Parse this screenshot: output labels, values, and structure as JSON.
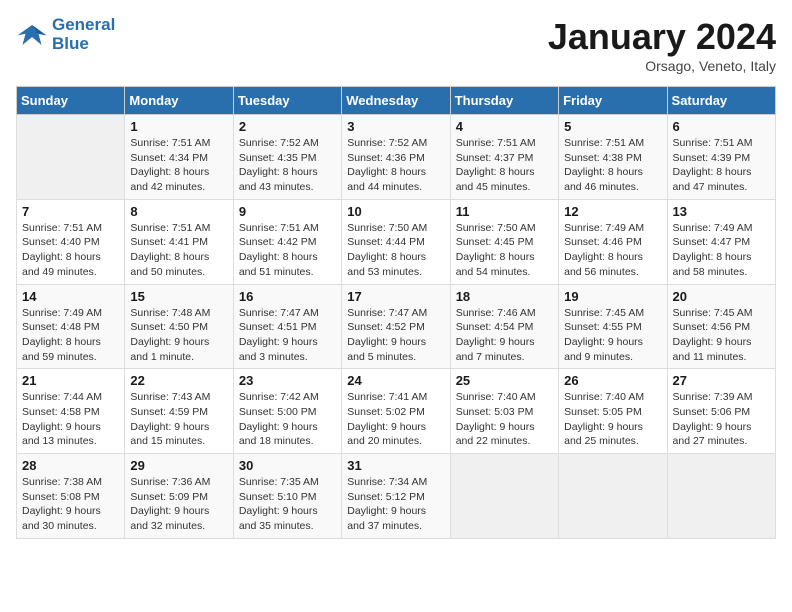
{
  "header": {
    "logo_line1": "General",
    "logo_line2": "Blue",
    "month_title": "January 2024",
    "location": "Orsago, Veneto, Italy"
  },
  "days_of_week": [
    "Sunday",
    "Monday",
    "Tuesday",
    "Wednesday",
    "Thursday",
    "Friday",
    "Saturday"
  ],
  "weeks": [
    [
      {
        "day": "",
        "info": ""
      },
      {
        "day": "1",
        "info": "Sunrise: 7:51 AM\nSunset: 4:34 PM\nDaylight: 8 hours\nand 42 minutes."
      },
      {
        "day": "2",
        "info": "Sunrise: 7:52 AM\nSunset: 4:35 PM\nDaylight: 8 hours\nand 43 minutes."
      },
      {
        "day": "3",
        "info": "Sunrise: 7:52 AM\nSunset: 4:36 PM\nDaylight: 8 hours\nand 44 minutes."
      },
      {
        "day": "4",
        "info": "Sunrise: 7:51 AM\nSunset: 4:37 PM\nDaylight: 8 hours\nand 45 minutes."
      },
      {
        "day": "5",
        "info": "Sunrise: 7:51 AM\nSunset: 4:38 PM\nDaylight: 8 hours\nand 46 minutes."
      },
      {
        "day": "6",
        "info": "Sunrise: 7:51 AM\nSunset: 4:39 PM\nDaylight: 8 hours\nand 47 minutes."
      }
    ],
    [
      {
        "day": "7",
        "info": "Sunrise: 7:51 AM\nSunset: 4:40 PM\nDaylight: 8 hours\nand 49 minutes."
      },
      {
        "day": "8",
        "info": "Sunrise: 7:51 AM\nSunset: 4:41 PM\nDaylight: 8 hours\nand 50 minutes."
      },
      {
        "day": "9",
        "info": "Sunrise: 7:51 AM\nSunset: 4:42 PM\nDaylight: 8 hours\nand 51 minutes."
      },
      {
        "day": "10",
        "info": "Sunrise: 7:50 AM\nSunset: 4:44 PM\nDaylight: 8 hours\nand 53 minutes."
      },
      {
        "day": "11",
        "info": "Sunrise: 7:50 AM\nSunset: 4:45 PM\nDaylight: 8 hours\nand 54 minutes."
      },
      {
        "day": "12",
        "info": "Sunrise: 7:49 AM\nSunset: 4:46 PM\nDaylight: 8 hours\nand 56 minutes."
      },
      {
        "day": "13",
        "info": "Sunrise: 7:49 AM\nSunset: 4:47 PM\nDaylight: 8 hours\nand 58 minutes."
      }
    ],
    [
      {
        "day": "14",
        "info": "Sunrise: 7:49 AM\nSunset: 4:48 PM\nDaylight: 8 hours\nand 59 minutes."
      },
      {
        "day": "15",
        "info": "Sunrise: 7:48 AM\nSunset: 4:50 PM\nDaylight: 9 hours\nand 1 minute."
      },
      {
        "day": "16",
        "info": "Sunrise: 7:47 AM\nSunset: 4:51 PM\nDaylight: 9 hours\nand 3 minutes."
      },
      {
        "day": "17",
        "info": "Sunrise: 7:47 AM\nSunset: 4:52 PM\nDaylight: 9 hours\nand 5 minutes."
      },
      {
        "day": "18",
        "info": "Sunrise: 7:46 AM\nSunset: 4:54 PM\nDaylight: 9 hours\nand 7 minutes."
      },
      {
        "day": "19",
        "info": "Sunrise: 7:45 AM\nSunset: 4:55 PM\nDaylight: 9 hours\nand 9 minutes."
      },
      {
        "day": "20",
        "info": "Sunrise: 7:45 AM\nSunset: 4:56 PM\nDaylight: 9 hours\nand 11 minutes."
      }
    ],
    [
      {
        "day": "21",
        "info": "Sunrise: 7:44 AM\nSunset: 4:58 PM\nDaylight: 9 hours\nand 13 minutes."
      },
      {
        "day": "22",
        "info": "Sunrise: 7:43 AM\nSunset: 4:59 PM\nDaylight: 9 hours\nand 15 minutes."
      },
      {
        "day": "23",
        "info": "Sunrise: 7:42 AM\nSunset: 5:00 PM\nDaylight: 9 hours\nand 18 minutes."
      },
      {
        "day": "24",
        "info": "Sunrise: 7:41 AM\nSunset: 5:02 PM\nDaylight: 9 hours\nand 20 minutes."
      },
      {
        "day": "25",
        "info": "Sunrise: 7:40 AM\nSunset: 5:03 PM\nDaylight: 9 hours\nand 22 minutes."
      },
      {
        "day": "26",
        "info": "Sunrise: 7:40 AM\nSunset: 5:05 PM\nDaylight: 9 hours\nand 25 minutes."
      },
      {
        "day": "27",
        "info": "Sunrise: 7:39 AM\nSunset: 5:06 PM\nDaylight: 9 hours\nand 27 minutes."
      }
    ],
    [
      {
        "day": "28",
        "info": "Sunrise: 7:38 AM\nSunset: 5:08 PM\nDaylight: 9 hours\nand 30 minutes."
      },
      {
        "day": "29",
        "info": "Sunrise: 7:36 AM\nSunset: 5:09 PM\nDaylight: 9 hours\nand 32 minutes."
      },
      {
        "day": "30",
        "info": "Sunrise: 7:35 AM\nSunset: 5:10 PM\nDaylight: 9 hours\nand 35 minutes."
      },
      {
        "day": "31",
        "info": "Sunrise: 7:34 AM\nSunset: 5:12 PM\nDaylight: 9 hours\nand 37 minutes."
      },
      {
        "day": "",
        "info": ""
      },
      {
        "day": "",
        "info": ""
      },
      {
        "day": "",
        "info": ""
      }
    ]
  ]
}
